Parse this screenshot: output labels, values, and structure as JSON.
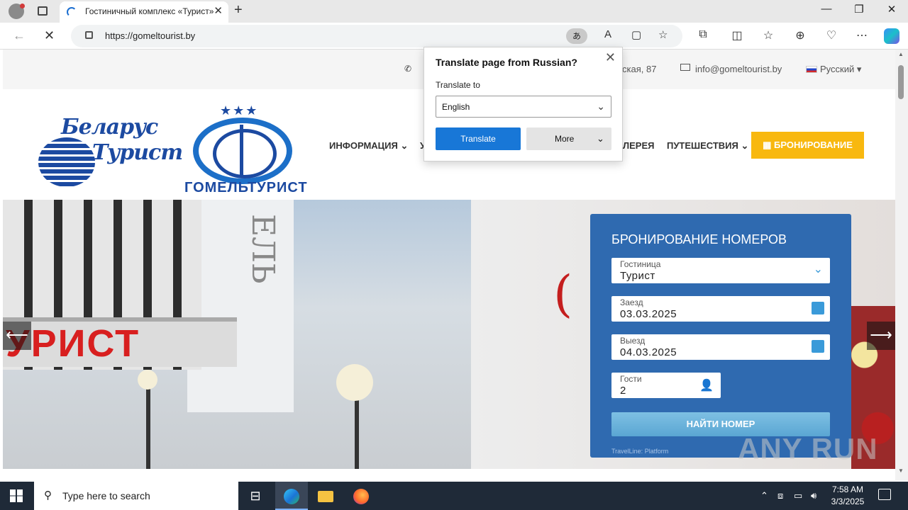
{
  "browser": {
    "tab_title": "Гостиничный комплекс «Турист»",
    "url_host": "https://gomeltourist.by",
    "translate_icon": "translate-icon"
  },
  "page": {
    "top_address": "ская, 87",
    "top_email": "info@gomeltourist.by",
    "top_lang": "Русский",
    "logo1_line1": "Беларус",
    "logo1_line2": "Турист",
    "logo2_name": "ГОМЕЛЬТУРИСТ",
    "menu": {
      "info": "ИНФОРМАЦИЯ",
      "u": "У",
      "gallery": "ЛЕРЕЯ",
      "travel": "ПУТЕШЕСТВИЯ",
      "booking": "БРОНИРОВАНИЕ"
    },
    "hero": {
      "sign": "УРИСТ",
      "tall_letters": "ЕЛЬ"
    },
    "booking_form": {
      "title": "БРОНИРОВАНИЕ НОМЕРОВ",
      "hotel_label": "Гостиница",
      "hotel_value": "Турист",
      "checkin_label": "Заезд",
      "checkin_value": "03.03.2025",
      "checkout_label": "Выезд",
      "checkout_value": "04.03.2025",
      "guests_label": "Гости",
      "guests_value": "2",
      "find_button": "НАЙТИ НОМЕР",
      "powered": "TravelLine: Platform"
    },
    "watermark": "ANY RUN"
  },
  "translate_popup": {
    "title": "Translate page from Russian?",
    "to_label": "Translate to",
    "language": "English",
    "translate_button": "Translate",
    "more_button": "More"
  },
  "taskbar": {
    "search_placeholder": "Type here to search",
    "time": "7:58 AM",
    "date": "3/3/2025"
  },
  "colors": {
    "booking_panel": "#2f6ab0",
    "accent_yellow": "#f8b80f",
    "translate_blue": "#1877d7"
  }
}
